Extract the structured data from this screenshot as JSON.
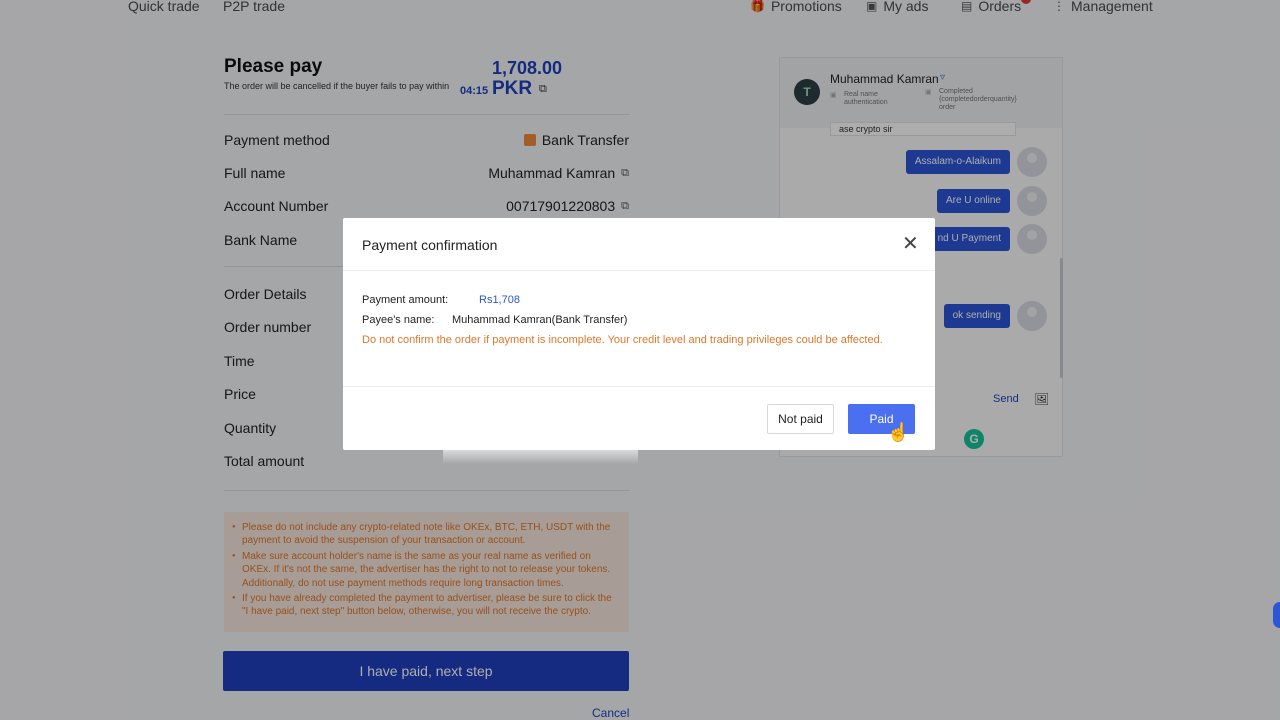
{
  "topnav": {
    "quick_trade": "Quick trade",
    "p2p_trade": "P2P trade",
    "promotions": "Promotions",
    "my_ads": "My ads",
    "orders": "Orders",
    "management": "Management"
  },
  "payment": {
    "title": "Please pay",
    "subtitle": "The order will be cancelled if the buyer fails to pay within",
    "amount": "1,708.00",
    "timer": "04:15",
    "currency": "PKR"
  },
  "details": {
    "payment_method_label": "Payment method",
    "payment_method_value": "Bank Transfer",
    "full_name_label": "Full name",
    "full_name_value": "Muhammad Kamran",
    "account_number_label": "Account Number",
    "account_number_value": "00717901220803",
    "bank_name_label": "Bank Name",
    "order_details_label": "Order Details",
    "order_number_label": "Order number",
    "time_label": "Time",
    "price_label": "Price",
    "quantity_label": "Quantity",
    "total_amount_label": "Total amount"
  },
  "notices": [
    "Please do not include any crypto-related note like OKEx, BTC, ETH, USDT with the payment to avoid the suspension of your transaction or account.",
    "Make sure account holder's name is the same as your real name as verified on OKEx. If it's not the same, the advertiser has the right to not to release your tokens. Additionally, do not use payment methods require long transaction times.",
    "If you have already completed the payment to advertiser, please be sure to click the \"I have paid, next step\" button below, otherwise, you will not receive the crypto."
  ],
  "actions": {
    "next_step": "I have paid, next step",
    "cancel": "Cancel"
  },
  "chat": {
    "merchant_name": "Muhammad Kamran",
    "avatar_letter": "T",
    "meta_auth": "Real name authentication",
    "meta_completed": "Completed {completedorderquantity} order",
    "partial_message": "ase crypto sir",
    "messages": [
      "Assalam-o-Alaikum",
      "Are U online",
      "nd U Payment",
      "ok sending"
    ],
    "send": "Send"
  },
  "modal": {
    "title": "Payment confirmation",
    "amount_label": "Payment amount:",
    "amount_value": "Rs1,708",
    "payee_label": "Payee's name:",
    "payee_value": "Muhammad Kamran(Bank Transfer)",
    "warning": "Do not confirm the order if payment is incomplete. Your credit level and trading privileges could be affected.",
    "not_paid": "Not paid",
    "paid": "Paid"
  },
  "icons": {
    "close": "close-icon",
    "copy": "copy-icon",
    "bank": "bank-icon",
    "cursor": "hand-cursor-icon"
  },
  "colors": {
    "brand_blue": "#1f3fbf",
    "button_blue": "#4a6ff0",
    "warning_orange": "#e0762b",
    "notification_red": "#e53935"
  }
}
